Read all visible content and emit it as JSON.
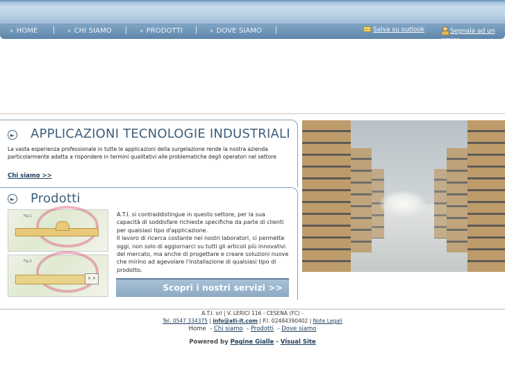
{
  "nav": {
    "items": [
      "HOME",
      "CHI SIAMO",
      "PRODOTTI",
      "DOVE SIAMO"
    ],
    "save_outlook": "Salva su outlook",
    "tell_friend": "Segnala ad un amico"
  },
  "section1": {
    "title": "APPLICAZIONI TECNOLOGIE INDUSTRIALI",
    "intro": "La vasta esperienza professionale in tutte le applicazioni della surgelazione rende la nostra azienda particolarmente adatta a rispondere in termini qualitativi alle problematiche degli operatori nel settore",
    "link": "Chi siamo >>"
  },
  "section2": {
    "title": "Prodotti",
    "text": "A.T.I.  si contraddistingue in questo settore, per la sua capacità di soddisfare richieste specifiche da parte di clienti per qualsiasi tipo d'applicazione.\nIl lavoro di ricerca costante nei nostri laboratori, ci permette oggi, non solo di aggiornarci su tutti gli articoli più innovativi del mercato, ma anche di progettare e creare soluzioni nuove che mirino ad agevolare l'installazione di qualsiasi tipo di prodotto.",
    "cta": "Scopri i nostri servizi >>",
    "img1_tag": "Fig.1",
    "img2_tag": "Fig.2"
  },
  "footer": {
    "line1": "A.T.I. srl | V. LERICI 116 - CESENA (FC) -",
    "tel": "Tel. 0547 334375",
    "email": "info@ati-it.com",
    "piva": "P.I. 02484390402",
    "legal": "Note Legali",
    "home": "Home",
    "chi": "Chi siamo",
    "prod": "Prodotti",
    "dove": "Dove siamo",
    "powered": "Powered by",
    "pg": "Pagine Gialle",
    "vs": "Visual Site"
  },
  "colors": {
    "nav_blue": "#6d93b6",
    "title_blue": "#3e5e79",
    "link_blue": "#1d3d5c"
  }
}
